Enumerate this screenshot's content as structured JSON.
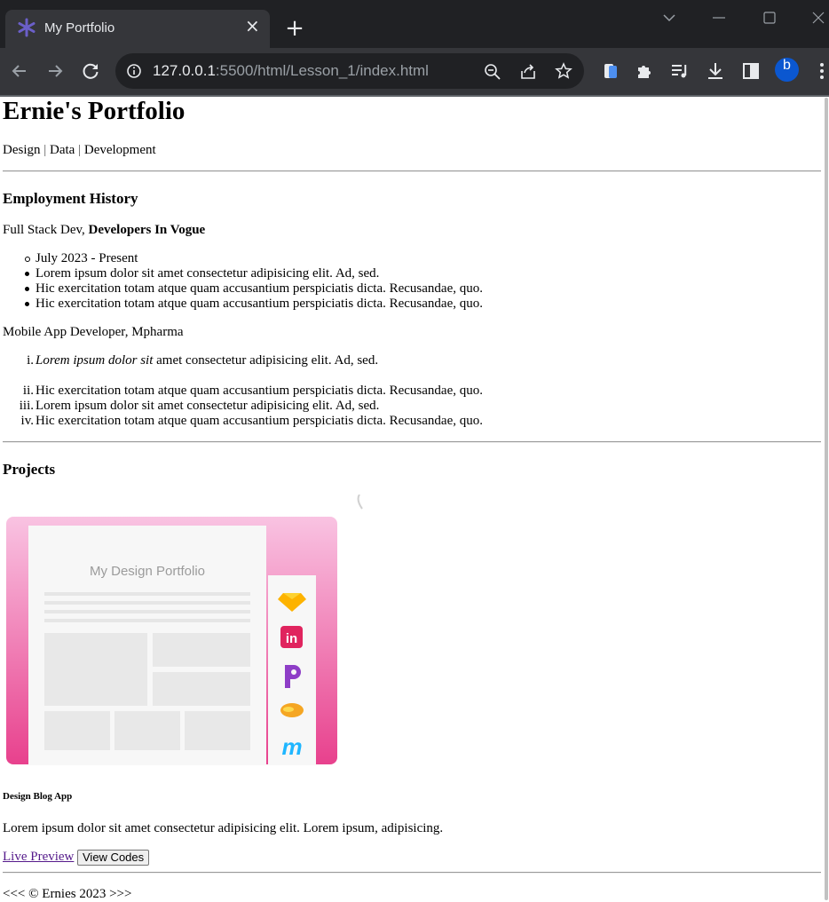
{
  "browser": {
    "tab_title": "My Portfolio",
    "url_host": "127.0.0.1",
    "url_rest": ":5500/html/Lesson_1/index.html",
    "profile_initial": "b",
    "icons": [
      "back-icon",
      "forward-icon",
      "reload-icon",
      "info-icon",
      "zoom-out-icon",
      "share-icon",
      "star-icon",
      "wallet-extension-icon",
      "puzzle-extensions-icon",
      "media-playlist-icon",
      "download-icon",
      "side-panel-icon",
      "menu-kebab-icon"
    ]
  },
  "header": {
    "title": "Ernie's Portfolio",
    "tagline_1": "Design",
    "sep_1": " | ",
    "tagline_2": "Data",
    "sep_2": " | ",
    "tagline_3": "Development"
  },
  "employment": {
    "heading": "Employment History",
    "job1": {
      "role": "Full Stack Dev, ",
      "company": "Developers In Vogue",
      "date": "July 2023 - Present",
      "items": [
        "Lorem ipsum dolor sit amet consectetur adipisicing elit. Ad, sed.",
        "Hic exercitation totam atque quam accusantium perspiciatis dicta. Recusandae, quo.",
        "Hic exercitation totam atque quam accusantium perspiciatis dicta. Recusandae, quo."
      ]
    },
    "job2": {
      "role": "Mobile App Developer, Mpharma",
      "first_italic": "Lorem ipsum dolor sit",
      "first_rest": " amet consectetur adipisicing elit. Ad, sed.",
      "numerals": [
        "i.",
        "ii.",
        "iii.",
        "iv."
      ],
      "items": [
        "Hic exercitation totam atque quam accusantium perspiciatis dicta. Recusandae, quo.",
        "Lorem ipsum dolor sit amet consectetur adipisicing elit. Ad, sed.",
        "Hic exercitation totam atque quam accusantium perspiciatis dicta. Recusandae, quo."
      ]
    }
  },
  "projects": {
    "heading": "Projects",
    "image_caption": "My Design Portfolio",
    "project_title": "Design Blog App",
    "description": "Lorem ipsum dolor sit amet consectetur adipisicing elit. Lorem ipsum, adipisicing.",
    "live_link": "Live Preview",
    "code_button": "View Codes"
  },
  "footer": {
    "text": "<<< © Ernies 2023 >>>"
  },
  "colors": {
    "pink_top": "#f9c3e2",
    "pink_bottom": "#e8418d",
    "link_visited": "#551a8b"
  }
}
